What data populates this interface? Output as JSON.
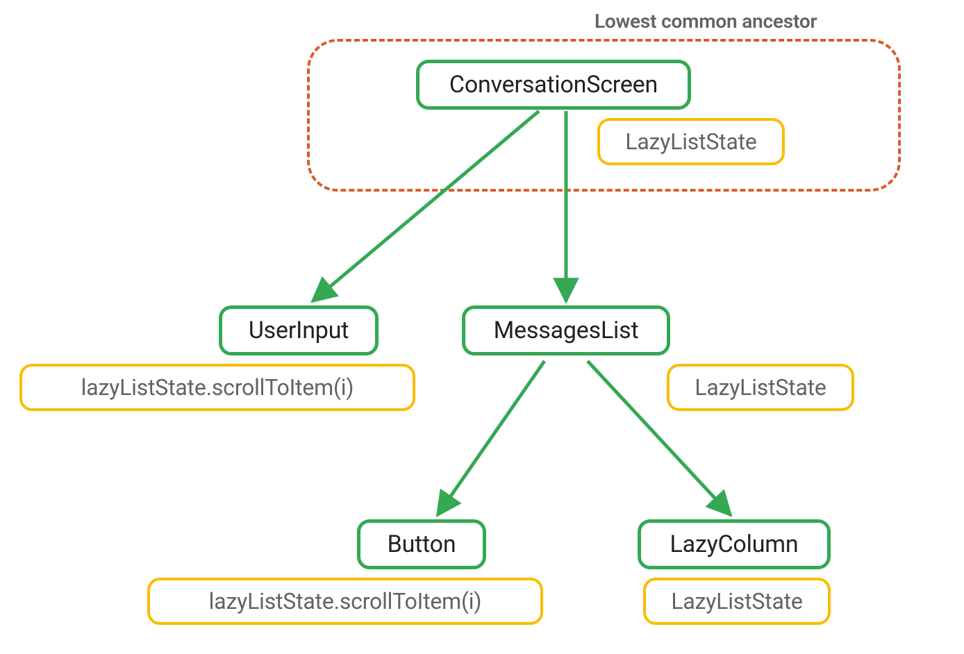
{
  "title_label": "Lowest common ancestor",
  "nodes": {
    "conversation_screen": "ConversationScreen",
    "lazy_list_state_root": "LazyListState",
    "user_input": "UserInput",
    "messages_list": "MessagesList",
    "lazy_list_state_ml": "LazyListState",
    "scroll_ui": "lazyListState.scrollToItem(i)",
    "button": "Button",
    "lazy_column": "LazyColumn",
    "scroll_btn": "lazyListState.scrollToItem(i)",
    "lazy_list_state_lc": "LazyListState"
  },
  "colors": {
    "green": "#34a853",
    "yellow": "#fbbc04",
    "dashed": "#d95d2c",
    "text_dark": "#202124",
    "text_gray": "#5f6368"
  }
}
